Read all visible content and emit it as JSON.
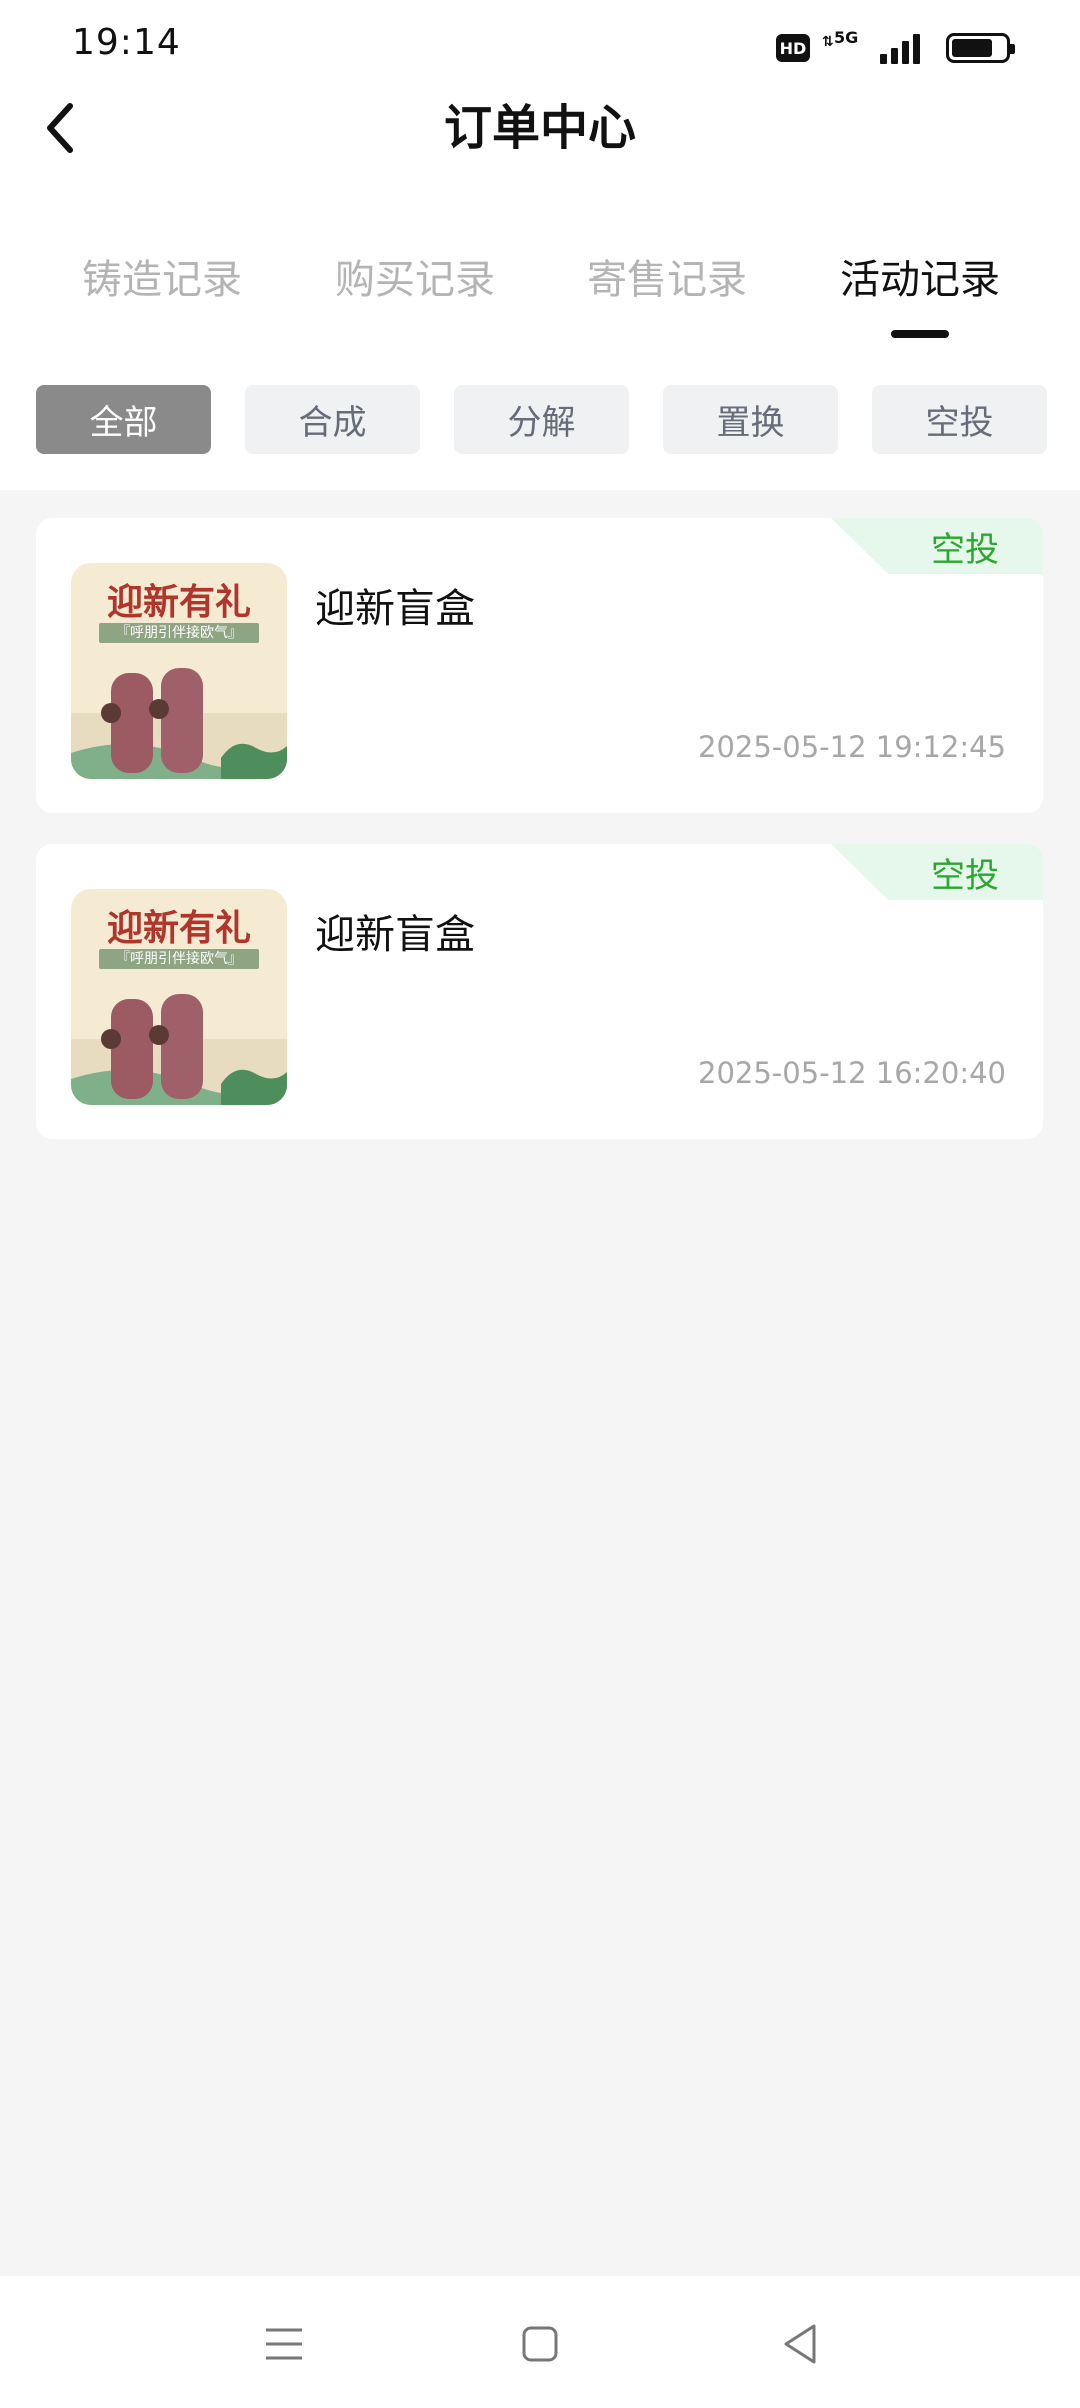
{
  "status_bar": {
    "time": "19:14",
    "hd_badge": "HD",
    "network": "5G",
    "battery_level_percent": 80
  },
  "header": {
    "back_icon": "chevron-left-icon",
    "title": "订单中心"
  },
  "tabs": [
    {
      "label": "铸造记录",
      "active": false
    },
    {
      "label": "购买记录",
      "active": false
    },
    {
      "label": "寄售记录",
      "active": false
    },
    {
      "label": "活动记录",
      "active": true
    }
  ],
  "filters": [
    {
      "label": "全部",
      "active": true
    },
    {
      "label": "合成",
      "active": false
    },
    {
      "label": "分解",
      "active": false
    },
    {
      "label": "置换",
      "active": false
    },
    {
      "label": "空投",
      "active": false
    }
  ],
  "records": [
    {
      "tag": "空投",
      "title": "迎新盲盒",
      "time": "2025-05-12 19:12:45",
      "thumb_title": "迎新有礼",
      "thumb_subtitle": "『呼朋引伴接欧气』"
    },
    {
      "tag": "空投",
      "title": "迎新盲盒",
      "time": "2025-05-12 16:20:40",
      "thumb_title": "迎新有礼",
      "thumb_subtitle": "『呼朋引伴接欧气』"
    }
  ],
  "bottom_nav": {
    "menu_icon": "menu-icon",
    "home_icon": "home-square-icon",
    "back_icon": "back-triangle-icon"
  },
  "colors": {
    "accent_green": "#2aa82e",
    "tag_bg": "#e6f7ec",
    "chip_active_bg": "#8a8a8a",
    "page_bg": "#f5f5f5"
  }
}
